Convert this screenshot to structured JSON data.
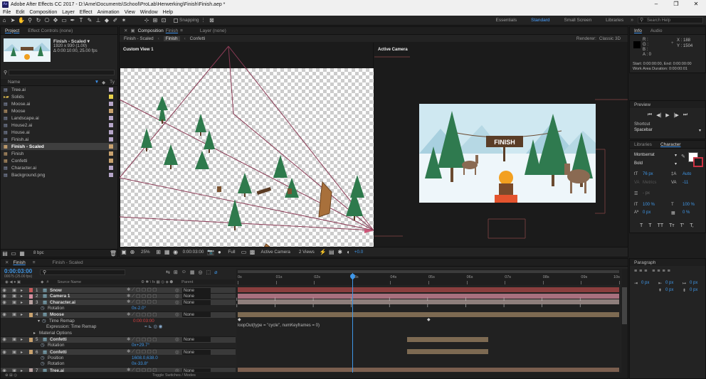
{
  "window": {
    "title": "Adobe After Effects CC 2017 - D:\\Arne\\Documents\\School\\ProLab\\Herwerking\\Finish\\Finish.aep *",
    "app_badge": "Ae",
    "minimize": "–",
    "maximize": "❐",
    "close": "✕"
  },
  "menu": [
    "File",
    "Edit",
    "Composition",
    "Layer",
    "Effect",
    "Animation",
    "View",
    "Window",
    "Help"
  ],
  "toolbar": {
    "snapping_label": "Snapping",
    "workspaces": [
      "Essentials",
      "Standard",
      "Small Screen",
      "Libraries"
    ],
    "active_workspace": "Standard",
    "search_placeholder": "Search Help",
    "more": "»"
  },
  "project": {
    "tabs": [
      "Project",
      "Effect Controls (none)"
    ],
    "thumb_name": "Finish - Scaled ▾",
    "thumb_line1": "1920 x 930 (1.00)",
    "thumb_line2": "Δ 0:00:10:00, 25.00 fps",
    "search_icon": "⚲",
    "col_name": "Name",
    "items": [
      {
        "name": "Tree.ai",
        "color": "#b6a6c9",
        "type": "file"
      },
      {
        "name": "Solids",
        "color": "#e8d24a",
        "type": "folder"
      },
      {
        "name": "Moose.ai",
        "color": "#b6a6c9",
        "type": "file"
      },
      {
        "name": "Moose",
        "color": "#c9a26f",
        "type": "comp"
      },
      {
        "name": "Landscape.ai",
        "color": "#b6a6c9",
        "type": "file"
      },
      {
        "name": "House2.ai",
        "color": "#b6a6c9",
        "type": "file"
      },
      {
        "name": "House.ai",
        "color": "#b6a6c9",
        "type": "file"
      },
      {
        "name": "Finish.ai",
        "color": "#b6a6c9",
        "type": "file"
      },
      {
        "name": "Finish - Scaled",
        "color": "#c9a26f",
        "type": "comp",
        "selected": true
      },
      {
        "name": "Finish",
        "color": "#c9a26f",
        "type": "comp"
      },
      {
        "name": "Confetti",
        "color": "#c9a26f",
        "type": "comp"
      },
      {
        "name": "Character.ai",
        "color": "#b6a6c9",
        "type": "file"
      },
      {
        "name": "Background.png",
        "color": "#b6a6c9",
        "type": "file"
      }
    ],
    "bpc": "8 bpc"
  },
  "composition": {
    "tab_prefix": "Composition",
    "tab_comp": "Finish",
    "layer_tab": "Layer (none)",
    "breadcrumbs": [
      "Finish - Scaled",
      "Finish",
      "Confetti"
    ],
    "renderer_label": "Renderer:",
    "renderer_value": "Classic 3D",
    "left_view_label": "Custom View 1",
    "right_view_label": "Active Camera",
    "finish_sign": "FINISH",
    "zoom": "25%",
    "timecode": "0:00:03:00",
    "resolution": "Full",
    "camera": "Active Camera",
    "views": "2 Views",
    "exposure": "+0.0"
  },
  "info": {
    "tabs": [
      "Info",
      "Audio"
    ],
    "r": "R :",
    "g": "G :",
    "b": "B :",
    "a": "A : 0",
    "x": "X : 188",
    "y": "Y : 1504",
    "line1": "Start: 0:00:00:00, End: 0:00:00:00",
    "line2": "Work Area Duration: 0:00:00:01"
  },
  "preview": {
    "title": "Preview",
    "controls": [
      "⏮",
      "◀|",
      "▶",
      "|▶",
      "⏭"
    ],
    "shortcut_label": "Shortcut",
    "shortcut_value": "Spacebar"
  },
  "character": {
    "tabs": [
      "Libraries",
      "Character"
    ],
    "font": "Montserrat",
    "style": "Bold",
    "size": "76 px",
    "leading": "Auto",
    "kerning": "Metrics",
    "tracking": "-11",
    "stroke": "- px",
    "vscale": "100 %",
    "hscale": "100 %",
    "baseline": "0 px",
    "tsume": "0 %",
    "styles": [
      "T",
      "T",
      "TT",
      "Tт",
      "T'",
      "T,"
    ]
  },
  "paragraph": {
    "title": "Paragraph",
    "indent1": "0 px",
    "indent2": "0 px",
    "indent3": "0 px",
    "indent4": "0 px",
    "indent5": "0 px"
  },
  "timeline": {
    "tabs": [
      "Finish",
      "Finish - Scaled"
    ],
    "timecode": "0:00:03:00",
    "timecode_sub": "00075 (25.00 fps)",
    "col_source": "Source Name",
    "col_parent": "Parent",
    "ruler": [
      "0s",
      "01s",
      "02s",
      "03s",
      "04s",
      "05s",
      "06s",
      "07s",
      "08s",
      "09s",
      "10s"
    ],
    "playhead_seconds": 3,
    "layers": [
      {
        "num": "1",
        "name": "Snow",
        "color": "#c65c5c",
        "parent": "None",
        "type": "layer"
      },
      {
        "num": "2",
        "name": "Camera 1",
        "color": "#d58fa0",
        "parent": "None",
        "type": "layer"
      },
      {
        "num": "3",
        "name": "Character.ai",
        "color": "#b9a2a0",
        "parent": "None",
        "type": "layer"
      },
      {
        "name": "Rotation",
        "value": "0x-2.0°",
        "type": "prop"
      },
      {
        "num": "4",
        "name": "Moose",
        "color": "#c9a26f",
        "parent": "None",
        "type": "layer"
      },
      {
        "name": "Time Remap",
        "value": "0:00:03:00",
        "type": "prop",
        "red": true
      },
      {
        "name": "Expression: Time Remap",
        "type": "expr"
      },
      {
        "name": "Material Options",
        "type": "sub"
      },
      {
        "num": "5",
        "name": "Confetti",
        "color": "#c9a26f",
        "parent": "None",
        "type": "layer"
      },
      {
        "name": "Rotation",
        "value": "0x+29.7°",
        "type": "prop"
      },
      {
        "num": "6",
        "name": "Confetti",
        "color": "#c9a26f",
        "parent": "None",
        "type": "layer"
      },
      {
        "name": "Position",
        "value": "1608.0,638.0",
        "type": "prop"
      },
      {
        "name": "Rotation",
        "value": "0x-33.8°",
        "type": "prop"
      },
      {
        "num": "7",
        "name": "Tree.ai",
        "color": "#b9a2a0",
        "parent": "None",
        "type": "layer"
      }
    ],
    "expression": "loopOut(type = \"cycle\", numKeyframes = 0)",
    "toggle_label": "Toggle Switches / Modes"
  }
}
